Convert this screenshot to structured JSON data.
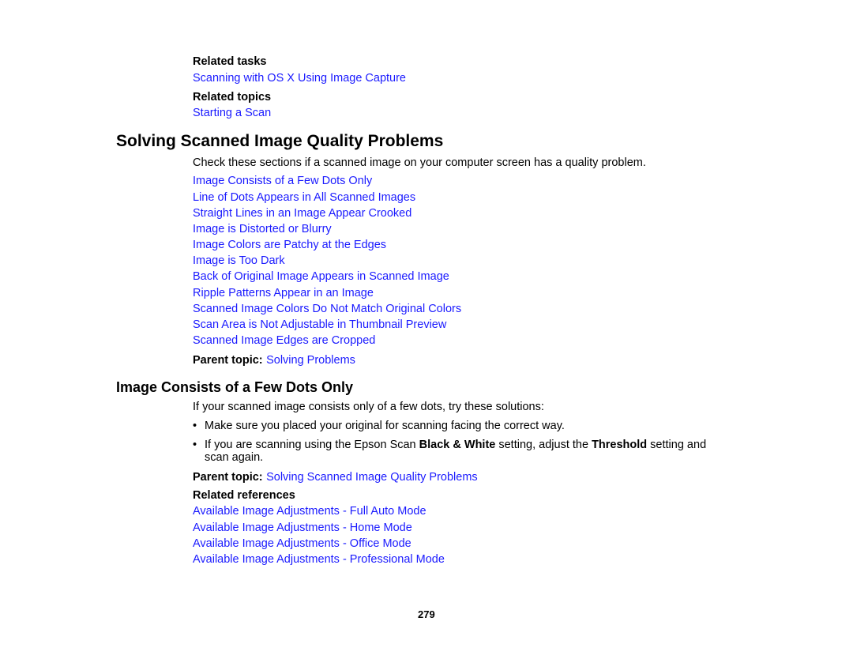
{
  "colors": {
    "link": "#1a1aff",
    "text": "#000000"
  },
  "top": {
    "related_tasks_label": "Related tasks",
    "related_tasks_link": "Scanning with OS X Using Image Capture",
    "related_topics_label": "Related topics",
    "related_topics_link": "Starting a Scan"
  },
  "section1": {
    "title": "Solving Scanned Image Quality Problems",
    "intro": "Check these sections if a scanned image on your computer screen has a quality problem.",
    "links": [
      "Image Consists of a Few Dots Only",
      "Line of Dots Appears in All Scanned Images",
      "Straight Lines in an Image Appear Crooked",
      "Image is Distorted or Blurry",
      "Image Colors are Patchy at the Edges",
      "Image is Too Dark",
      "Back of Original Image Appears in Scanned Image",
      "Ripple Patterns Appear in an Image",
      "Scanned Image Colors Do Not Match Original Colors",
      "Scan Area is Not Adjustable in Thumbnail Preview",
      "Scanned Image Edges are Cropped"
    ],
    "parent_label": "Parent topic:",
    "parent_link": "Solving Problems"
  },
  "section2": {
    "title": "Image Consists of a Few Dots Only",
    "intro": "If your scanned image consists only of a few dots, try these solutions:",
    "bullet_char": "•",
    "bullet1": "Make sure you placed your original for scanning facing the correct way.",
    "bullet2": {
      "part1": "If you are scanning using the Epson Scan ",
      "bold1": "Black & White",
      "part2": " setting, adjust the ",
      "bold2": "Threshold",
      "part3": " setting and",
      "line2": "scan again."
    },
    "parent_label": "Parent topic:",
    "parent_link": "Solving Scanned Image Quality Problems",
    "related_references_label": "Related references",
    "related_references": [
      "Available Image Adjustments - Full Auto Mode",
      "Available Image Adjustments - Home Mode",
      "Available Image Adjustments - Office Mode",
      "Available Image Adjustments - Professional Mode"
    ]
  },
  "footer": {
    "page_number": "279"
  }
}
